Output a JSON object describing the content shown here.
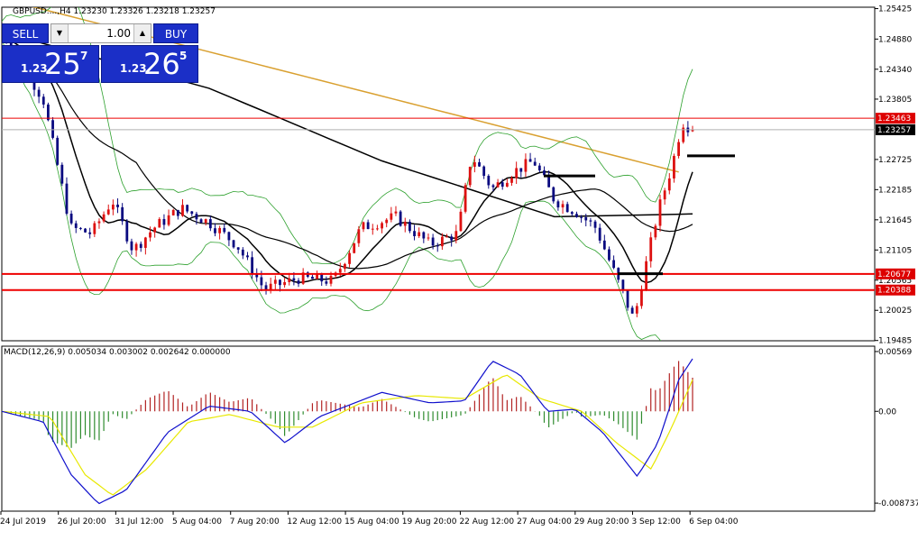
{
  "window": {
    "title": "GBPUSD....,H4  1.23230 1.23326 1.23218 1.23257",
    "macd_label": "MACD(12,26,9) 0.005034 0.003002 0.002642 0.000000"
  },
  "trade_panel": {
    "sell_label": "SELL",
    "buy_label": "BUY",
    "lot": "1.00",
    "sell_prefix": "1.23",
    "sell_big": "25",
    "sell_pip": "7",
    "buy_prefix": "1.23",
    "buy_big": "26",
    "buy_pip": "5"
  },
  "colors": {
    "up_candle": "#dd1111",
    "down_candle": "#0a0a80",
    "bands": "#2ca02c",
    "ma_long": "#d9a030",
    "ma_black": "#000000",
    "macd_main": "#1010cc",
    "macd_signal": "#e8e800",
    "level_line": "#ee0000",
    "price_tag": "#dd0000"
  },
  "chart_data": [
    {
      "type": "candlestick",
      "symbol": "GBPUSD",
      "timeframe": "H4",
      "ylim": [
        1.1948,
        1.2545
      ],
      "y_ticks": [
        "1.25425",
        "1.24880",
        "1.24340",
        "1.23805",
        "1.22725",
        "1.22185",
        "1.21645",
        "1.21105",
        "1.20565",
        "1.20025",
        "1.19485"
      ],
      "x_labels": [
        "24 Jul 2019",
        "26 Jul 20:00",
        "31 Jul 12:00",
        "5 Aug 04:00",
        "7 Aug 20:00",
        "12 Aug 12:00",
        "15 Aug 04:00",
        "19 Aug 20:00",
        "22 Aug 12:00",
        "27 Aug 04:00",
        "29 Aug 20:00",
        "3 Sep 12:00",
        "6 Sep 04:00"
      ],
      "last": {
        "open": 1.2323,
        "high": 1.23326,
        "low": 1.23218,
        "close": 1.23257
      },
      "horizontal_levels": [
        {
          "value": 1.23463,
          "label": "1.23463"
        },
        {
          "value": 1.20677,
          "label": "1.20677"
        },
        {
          "value": 1.20388,
          "label": "1.20388"
        }
      ],
      "current_price_label": "1.23257",
      "key_points": [
        {
          "t": 0.0,
          "price": 1.2505
        },
        {
          "t": 0.06,
          "price": 1.238
        },
        {
          "t": 0.1,
          "price": 1.215
        },
        {
          "t": 0.13,
          "price": 1.214
        },
        {
          "t": 0.16,
          "price": 1.22
        },
        {
          "t": 0.19,
          "price": 1.211
        },
        {
          "t": 0.22,
          "price": 1.215
        },
        {
          "t": 0.26,
          "price": 1.2185
        },
        {
          "t": 0.3,
          "price": 1.216
        },
        {
          "t": 0.34,
          "price": 1.212
        },
        {
          "t": 0.38,
          "price": 1.204
        },
        {
          "t": 0.43,
          "price": 1.206
        },
        {
          "t": 0.48,
          "price": 1.2055
        },
        {
          "t": 0.52,
          "price": 1.215
        },
        {
          "t": 0.57,
          "price": 1.217
        },
        {
          "t": 0.62,
          "price": 1.212
        },
        {
          "t": 0.66,
          "price": 1.214
        },
        {
          "t": 0.68,
          "price": 1.228
        },
        {
          "t": 0.71,
          "price": 1.222
        },
        {
          "t": 0.74,
          "price": 1.225
        },
        {
          "t": 0.77,
          "price": 1.227
        },
        {
          "t": 0.8,
          "price": 1.22
        },
        {
          "t": 0.83,
          "price": 1.218
        },
        {
          "t": 0.86,
          "price": 1.215
        },
        {
          "t": 0.9,
          "price": 1.203
        },
        {
          "t": 0.915,
          "price": 1.1985
        },
        {
          "t": 0.93,
          "price": 1.207
        },
        {
          "t": 0.95,
          "price": 1.218
        },
        {
          "t": 0.97,
          "price": 1.226
        },
        {
          "t": 0.985,
          "price": 1.234
        },
        {
          "t": 1.0,
          "price": 1.23257
        }
      ]
    },
    {
      "type": "histogram+line",
      "name": "MACD(12,26,9)",
      "ylim": [
        -0.0095,
        0.0062
      ],
      "y_ticks": [
        "0.00569",
        "0.00",
        "-0.008737"
      ],
      "main": [
        {
          "t": 0.0,
          "v": 0.0
        },
        {
          "t": 0.06,
          "v": -0.001
        },
        {
          "t": 0.1,
          "v": -0.006
        },
        {
          "t": 0.14,
          "v": -0.0088
        },
        {
          "t": 0.18,
          "v": -0.0075
        },
        {
          "t": 0.24,
          "v": -0.002
        },
        {
          "t": 0.3,
          "v": 0.0005
        },
        {
          "t": 0.36,
          "v": 0.0
        },
        {
          "t": 0.41,
          "v": -0.003
        },
        {
          "t": 0.46,
          "v": -0.0005
        },
        {
          "t": 0.55,
          "v": 0.0018
        },
        {
          "t": 0.62,
          "v": 0.0008
        },
        {
          "t": 0.67,
          "v": 0.001
        },
        {
          "t": 0.71,
          "v": 0.0048
        },
        {
          "t": 0.75,
          "v": 0.0035
        },
        {
          "t": 0.79,
          "v": 0.0
        },
        {
          "t": 0.83,
          "v": 0.0002
        },
        {
          "t": 0.87,
          "v": -0.002
        },
        {
          "t": 0.92,
          "v": -0.0062
        },
        {
          "t": 0.95,
          "v": -0.003
        },
        {
          "t": 0.98,
          "v": 0.003
        },
        {
          "t": 1.0,
          "v": 0.005
        }
      ],
      "signal": [
        {
          "t": 0.0,
          "v": 0.0
        },
        {
          "t": 0.07,
          "v": -0.0005
        },
        {
          "t": 0.12,
          "v": -0.006
        },
        {
          "t": 0.16,
          "v": -0.008
        },
        {
          "t": 0.21,
          "v": -0.0055
        },
        {
          "t": 0.27,
          "v": -0.001
        },
        {
          "t": 0.33,
          "v": -0.0003
        },
        {
          "t": 0.4,
          "v": -0.0015
        },
        {
          "t": 0.45,
          "v": -0.0015
        },
        {
          "t": 0.52,
          "v": 0.0008
        },
        {
          "t": 0.6,
          "v": 0.0015
        },
        {
          "t": 0.67,
          "v": 0.0012
        },
        {
          "t": 0.73,
          "v": 0.0035
        },
        {
          "t": 0.78,
          "v": 0.0012
        },
        {
          "t": 0.84,
          "v": 0.0
        },
        {
          "t": 0.89,
          "v": -0.003
        },
        {
          "t": 0.94,
          "v": -0.0055
        },
        {
          "t": 0.97,
          "v": -0.0015
        },
        {
          "t": 1.0,
          "v": 0.003
        }
      ],
      "histogram_note_values": [
        0.0005,
        -0.0028,
        0.0012,
        -0.001,
        0.0008,
        -0.0015,
        0.0026
      ]
    }
  ]
}
